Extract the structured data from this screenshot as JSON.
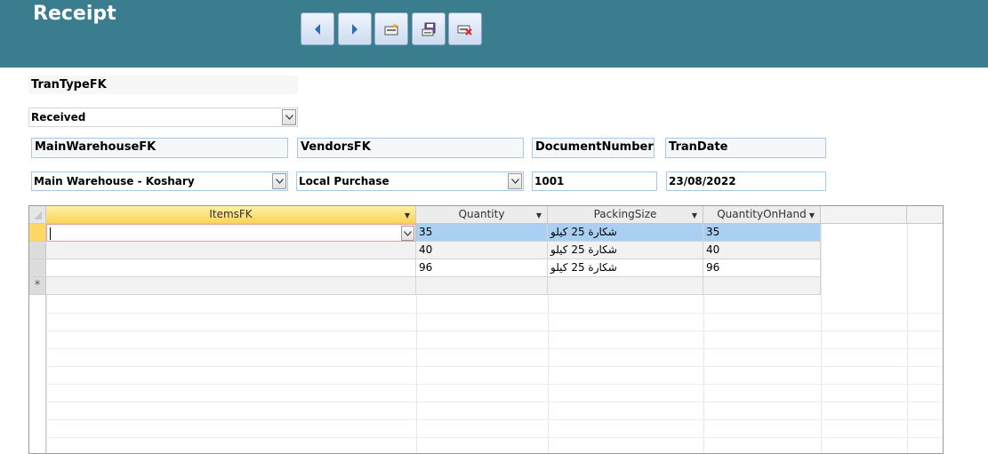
{
  "header": {
    "title": "Receipt",
    "buttons": [
      {
        "name": "previous-record-button",
        "icon": "arrow-left-icon"
      },
      {
        "name": "next-record-button",
        "icon": "arrow-right-icon"
      },
      {
        "name": "new-record-button",
        "icon": "new-record-icon"
      },
      {
        "name": "save-record-button",
        "icon": "save-icon"
      },
      {
        "name": "delete-record-button",
        "icon": "delete-icon"
      }
    ],
    "colors": {
      "bar": "#3a7d8f",
      "title": "#ffffff"
    }
  },
  "form": {
    "tran_type_label": "TranTypeFK",
    "tran_type_value": "Received",
    "main_warehouse_label": "MainWarehouseFK",
    "main_warehouse_value": "Main Warehouse - Koshary",
    "vendors_label": "VendorsFK",
    "vendors_value": "Local Purchase",
    "document_number_label": "DocumentNumber",
    "document_number_value": "1001",
    "tran_date_label": "TranDate",
    "tran_date_value": "23/08/2022"
  },
  "grid": {
    "columns": [
      "ItemsFK",
      "Quantity",
      "PackingSize",
      "QuantityOnHand"
    ],
    "rows": [
      {
        "items": "",
        "quantity": "35",
        "packing": "شكارة 25 كيلو",
        "on_hand": "35"
      },
      {
        "items": "",
        "quantity": "40",
        "packing": "شكارة 25 كيلو",
        "on_hand": "40"
      },
      {
        "items": "",
        "quantity": "96",
        "packing": "شكارة 25 كيلو",
        "on_hand": "96"
      }
    ],
    "new_row_marker": "*",
    "colors": {
      "selected_header": "#fbd45a",
      "selected_row": "#a9cff2",
      "current_selector": "#ffd862"
    }
  }
}
